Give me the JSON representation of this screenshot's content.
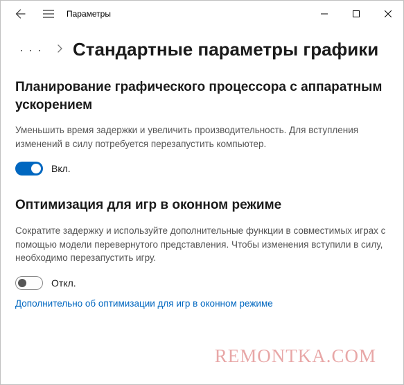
{
  "titlebar": {
    "app_name": "Параметры"
  },
  "breadcrumb": {
    "dots": "· · ·",
    "title": "Стандартные параметры графики"
  },
  "section1": {
    "heading": "Планирование графического процессора с аппаратным ускорением",
    "desc": "Уменьшить время задержки и увеличить производительность. Для вступления изменений в силу потребуется перезапустить компьютер.",
    "toggle_state": true,
    "toggle_label": "Вкл."
  },
  "section2": {
    "heading": "Оптимизация для игр в оконном режиме",
    "desc": "Сократите задержку и используйте дополнительные функции в совместимых играх с помощью модели перевернутого представления. Чтобы изменения вступили в силу, необходимо перезапустить игру.",
    "toggle_state": false,
    "toggle_label": "Откл.",
    "link": "Дополнительно об оптимизации для игр в оконном режиме"
  },
  "watermark": "REMONTKA.COM"
}
